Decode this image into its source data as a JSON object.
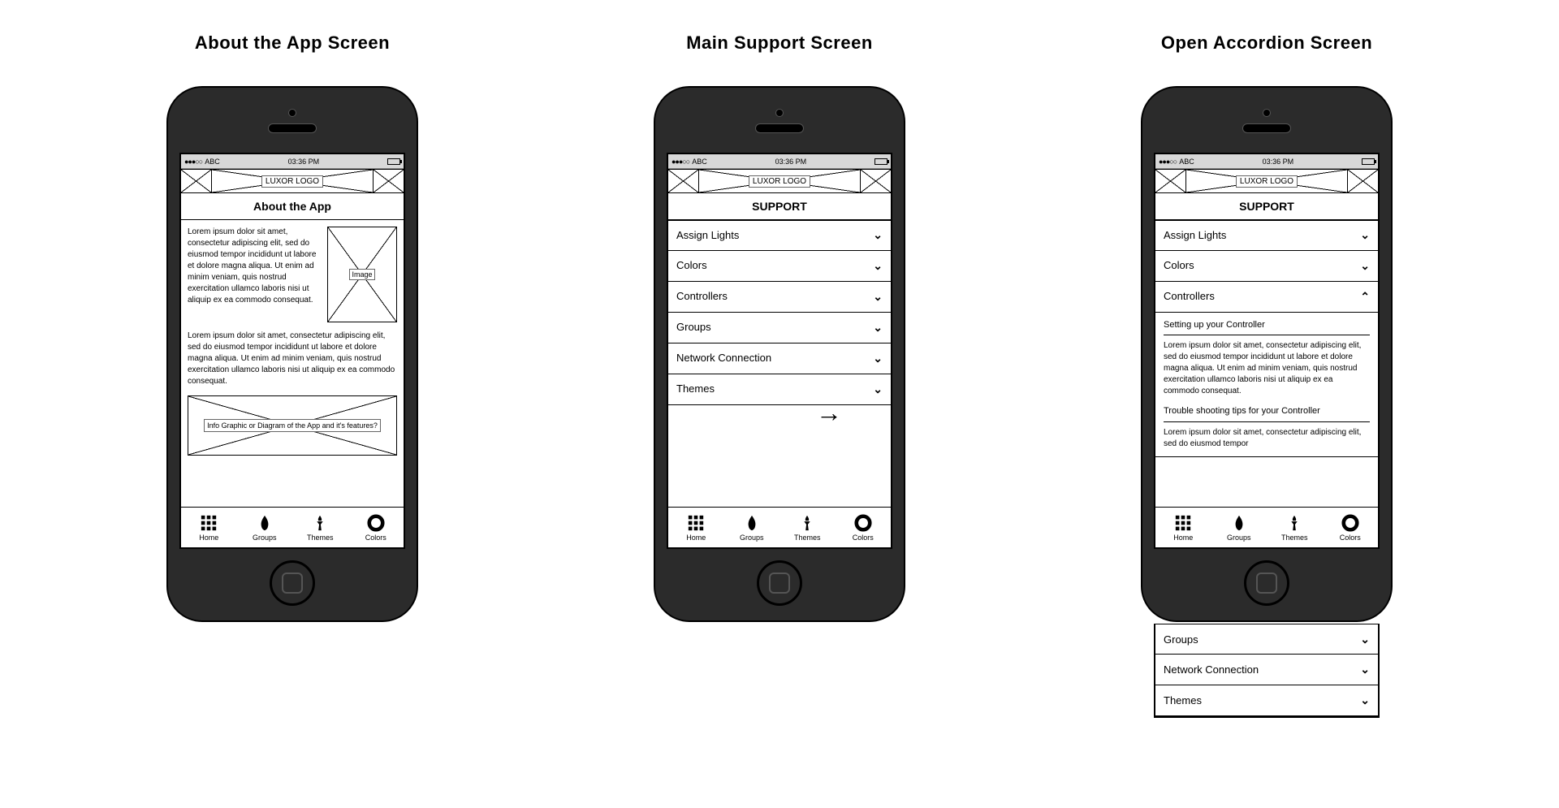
{
  "screens": {
    "about": {
      "title": "About the App Screen",
      "header": "About the App"
    },
    "support": {
      "title": "Main Support Screen",
      "header": "SUPPORT"
    },
    "accordion": {
      "title": "Open Accordion Screen",
      "header": "SUPPORT"
    }
  },
  "statusbar": {
    "carrier": "ABC",
    "time": "03:36 PM"
  },
  "logo": {
    "text": "LUXOR LOGO"
  },
  "about": {
    "para1": "Lorem ipsum dolor sit amet, consectetur adipiscing elit, sed do eiusmod tempor incididunt ut labore et dolore magna aliqua. Ut enim ad minim veniam, quis nostrud exercitation ullamco laboris nisi ut aliquip ex ea commodo consequat.",
    "para2": "Lorem ipsum dolor sit amet, consectetur adipiscing elit, sed do eiusmod tempor incididunt ut labore et dolore magna aliqua. Ut enim ad minim veniam, quis nostrud exercitation ullamco laboris nisi ut aliquip ex ea commodo consequat.",
    "image_label": "Image",
    "info_label": "Info Graphic or Diagram of the App and it's features?"
  },
  "support_items": {
    "i0": "Assign Lights",
    "i1": "Colors",
    "i2": "Controllers",
    "i3": "Groups",
    "i4": "Network Connection",
    "i5": "Themes"
  },
  "accordion_content": {
    "sub1": "Setting up your Controller",
    "body1": "Lorem ipsum dolor sit amet, consectetur adipiscing elit, sed do eiusmod tempor incididunt ut labore et dolore magna aliqua. Ut enim ad minim veniam, quis nostrud exercitation ullamco laboris nisi ut aliquip ex ea commodo consequat.",
    "sub2": "Trouble shooting tips for your Controller",
    "body2": "Lorem ipsum dolor sit amet, consectetur adipiscing elit, sed do eiusmod tempor"
  },
  "tabs": {
    "home": "Home",
    "groups": "Groups",
    "themes": "Themes",
    "colors": "Colors"
  },
  "icons": {
    "chev_down": "⌄",
    "chev_up": "⌃",
    "arrow": "→"
  }
}
